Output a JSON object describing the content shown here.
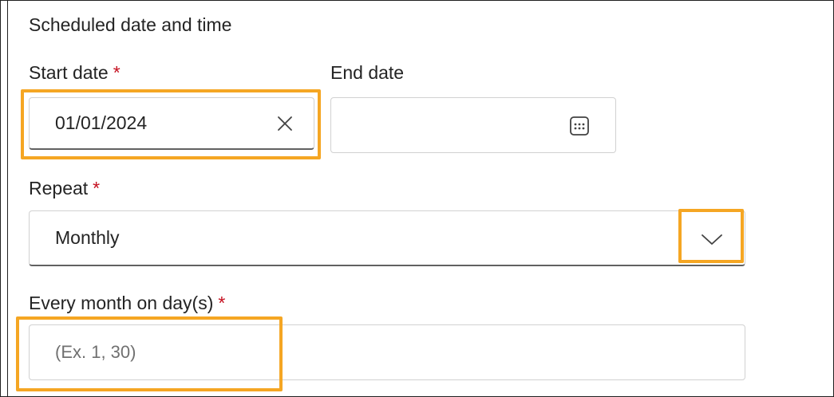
{
  "section": {
    "title": "Scheduled date and time"
  },
  "start_date": {
    "label": "Start date",
    "required_mark": "*",
    "value": "01/01/2024",
    "clear_icon": "close-icon"
  },
  "end_date": {
    "label": "End date",
    "value": "",
    "calendar_icon": "calendar-icon"
  },
  "repeat": {
    "label": "Repeat",
    "required_mark": "*",
    "selected": "Monthly",
    "dropdown_icon": "chevron-down-icon"
  },
  "days": {
    "label": "Every month on day(s)",
    "required_mark": "*",
    "value": "",
    "placeholder": "(Ex. 1, 30)"
  },
  "colors": {
    "highlight": "#f5a623",
    "required": "#c50f1f",
    "field_border": "#d1d1d1",
    "field_underline": "#616161"
  }
}
